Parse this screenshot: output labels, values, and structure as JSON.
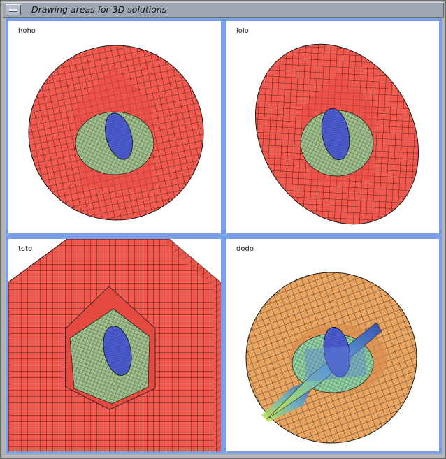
{
  "window": {
    "title": "Drawing areas for 3D solutions",
    "menu_icon": "window-menu-icon"
  },
  "panes": [
    {
      "id": "top-left",
      "label": "hoho",
      "shape": "sphere"
    },
    {
      "id": "top-right",
      "label": "lolo",
      "shape": "ellipsoid"
    },
    {
      "id": "bottom-left",
      "label": "toto",
      "shape": "cube"
    },
    {
      "id": "bottom-right",
      "label": "dodo",
      "shape": "sphere-with-cross-section"
    }
  ],
  "colors": {
    "outer_red": "#f4594f",
    "outer_orange": "#e9a560",
    "middle_green": "#9ec08a",
    "inner_blue": "#4b5ccf",
    "mesh": "#1a1a1a",
    "pane_border": "#7b9fe2"
  }
}
